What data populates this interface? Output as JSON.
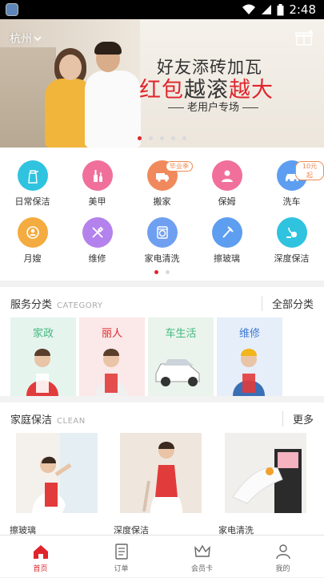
{
  "status_bar": {
    "time": "2:48"
  },
  "banner": {
    "city": "杭州",
    "line1": "好友添砖加瓦",
    "line2_red1": "红包",
    "line2_dark": "越滚",
    "line2_red2": "越大",
    "line3": "老用户专场",
    "page_count": 5,
    "active_page": 0
  },
  "services": [
    {
      "label": "日常保洁",
      "icon": "spray-bottle-icon",
      "color": "#2fc3df"
    },
    {
      "label": "美甲",
      "icon": "nail-polish-icon",
      "color": "#f0709b"
    },
    {
      "label": "搬家",
      "icon": "moving-truck-icon",
      "color": "#f08a5c",
      "tag": "毕业季"
    },
    {
      "label": "保姆",
      "icon": "nanny-icon",
      "color": "#f0709b"
    },
    {
      "label": "洗车",
      "icon": "car-icon",
      "color": "#5d9ef0",
      "tag": "10元起"
    },
    {
      "label": "月嫂",
      "icon": "baby-care-icon",
      "color": "#f4ab3f"
    },
    {
      "label": "维修",
      "icon": "repair-tools-icon",
      "color": "#b482ec"
    },
    {
      "label": "家电清洗",
      "icon": "washing-machine-icon",
      "color": "#6f9ff0"
    },
    {
      "label": "擦玻璃",
      "icon": "squeegee-icon",
      "color": "#5d9ef0"
    },
    {
      "label": "深度保洁",
      "icon": "vacuum-icon",
      "color": "#2fc3df"
    }
  ],
  "services_pager": {
    "page_count": 2,
    "active_page": 0
  },
  "categories": {
    "title": "服务分类",
    "title_en": "CATEGORY",
    "more": "全部分类",
    "items": [
      {
        "label": "家政",
        "color": "#43b97f",
        "bg": "#e6f4ee"
      },
      {
        "label": "丽人",
        "color": "#e0242c",
        "bg": "#fbe8e8"
      },
      {
        "label": "车生活",
        "color": "#43b97f",
        "bg": "#eaf4ec"
      },
      {
        "label": "维修",
        "color": "#3f7ad3",
        "bg": "#e6eefa"
      }
    ]
  },
  "home_cleaning": {
    "title": "家庭保洁",
    "title_en": "CLEAN",
    "more": "更多",
    "items": [
      {
        "label": "擦玻璃"
      },
      {
        "label": "深度保洁"
      },
      {
        "label": "家电清洗"
      }
    ]
  },
  "tabbar": {
    "accent": "#e0242c",
    "items": [
      {
        "label": "首页",
        "icon": "home-icon",
        "active": true
      },
      {
        "label": "订单",
        "icon": "order-icon",
        "active": false
      },
      {
        "label": "会员卡",
        "icon": "crown-icon",
        "active": false
      },
      {
        "label": "我的",
        "icon": "profile-icon",
        "active": false
      }
    ]
  }
}
